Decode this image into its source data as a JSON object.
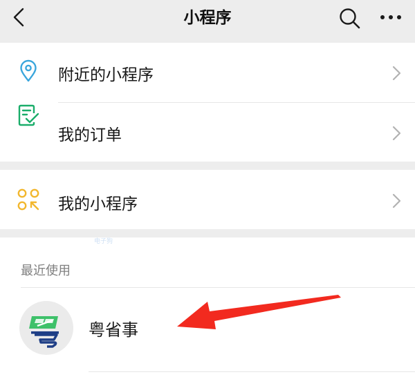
{
  "nav": {
    "title": "小程序",
    "back_icon": "chevron-left-icon",
    "search_icon": "search-icon",
    "more_icon": "more-horizontal-icon"
  },
  "menu": {
    "nearby": {
      "label": "附近的小程序",
      "icon": "location-pin-icon"
    },
    "orders": {
      "label": "我的订单",
      "icon": "order-list-icon"
    },
    "my_apps": {
      "label": "我的小程序",
      "icon": "mini-program-grid-icon"
    }
  },
  "recent": {
    "section_label": "最近使用",
    "items": [
      {
        "name": "粤省事",
        "logo": "yue-sheng-shi-logo"
      }
    ]
  },
  "watermark": {
    "text": "电子狗"
  },
  "colors": {
    "background": "#ededed",
    "card": "#ffffff",
    "location_icon": "#3aa6dc",
    "order_icon": "#1aad6a",
    "grid_icon": "#f2b72e",
    "arrow": "#f22a1f",
    "logo_green": "#3ec16a",
    "logo_navy": "#1f3f86"
  }
}
